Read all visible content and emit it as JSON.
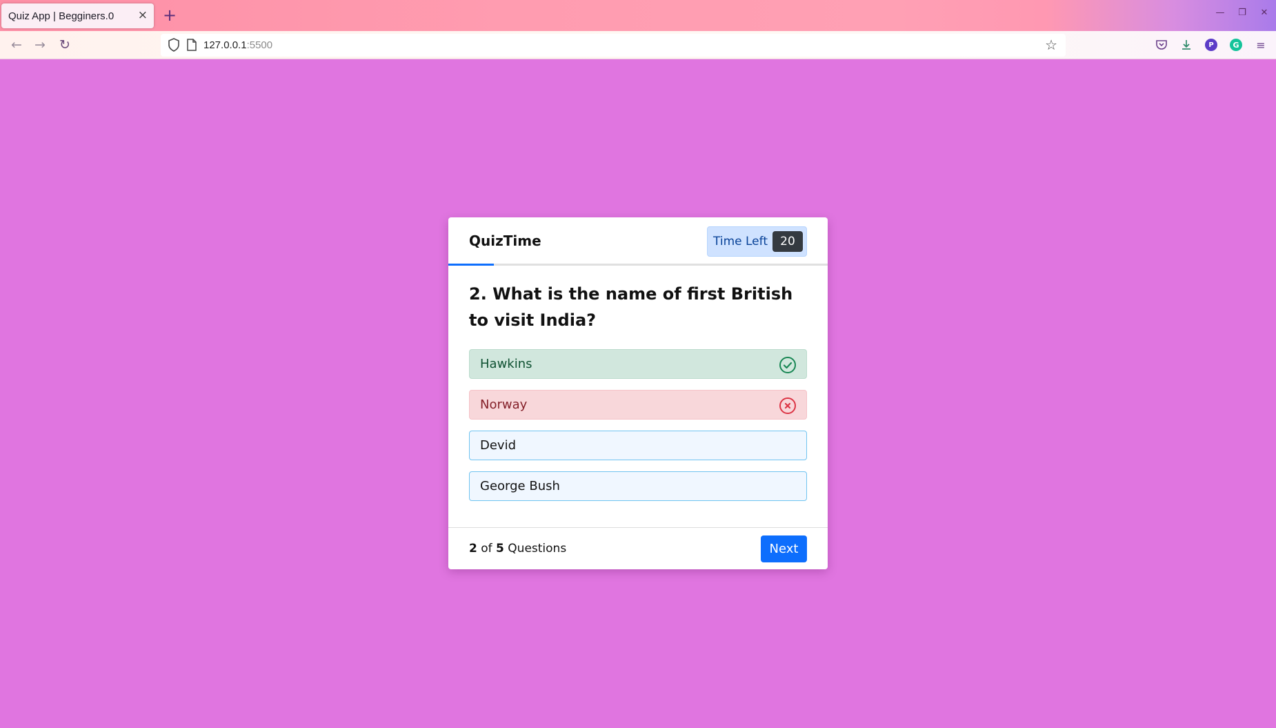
{
  "browser": {
    "tab_title": "Quiz App | Begginers.0",
    "tab_close": "×",
    "new_tab": "+",
    "url_host": "127.0.0.1",
    "url_port": ":5500"
  },
  "quiz": {
    "brand": "QuizTime",
    "timer_label": "Time Left",
    "timer_value": "20",
    "question": "2. What is the name of first British to visit India?",
    "options": [
      {
        "label": "Hawkins",
        "state": "correct"
      },
      {
        "label": "Norway",
        "state": "wrong"
      },
      {
        "label": "Devid",
        "state": "neutral"
      },
      {
        "label": "George Bush",
        "state": "neutral"
      }
    ],
    "progress": {
      "current": "2",
      "of": "of",
      "total": "5",
      "suffix": "Questions"
    },
    "next_label": "Next"
  },
  "colors": {
    "page_background": "#e075e0",
    "primary": "#0d6efd",
    "correct": "#198754",
    "wrong": "#dc3545"
  }
}
